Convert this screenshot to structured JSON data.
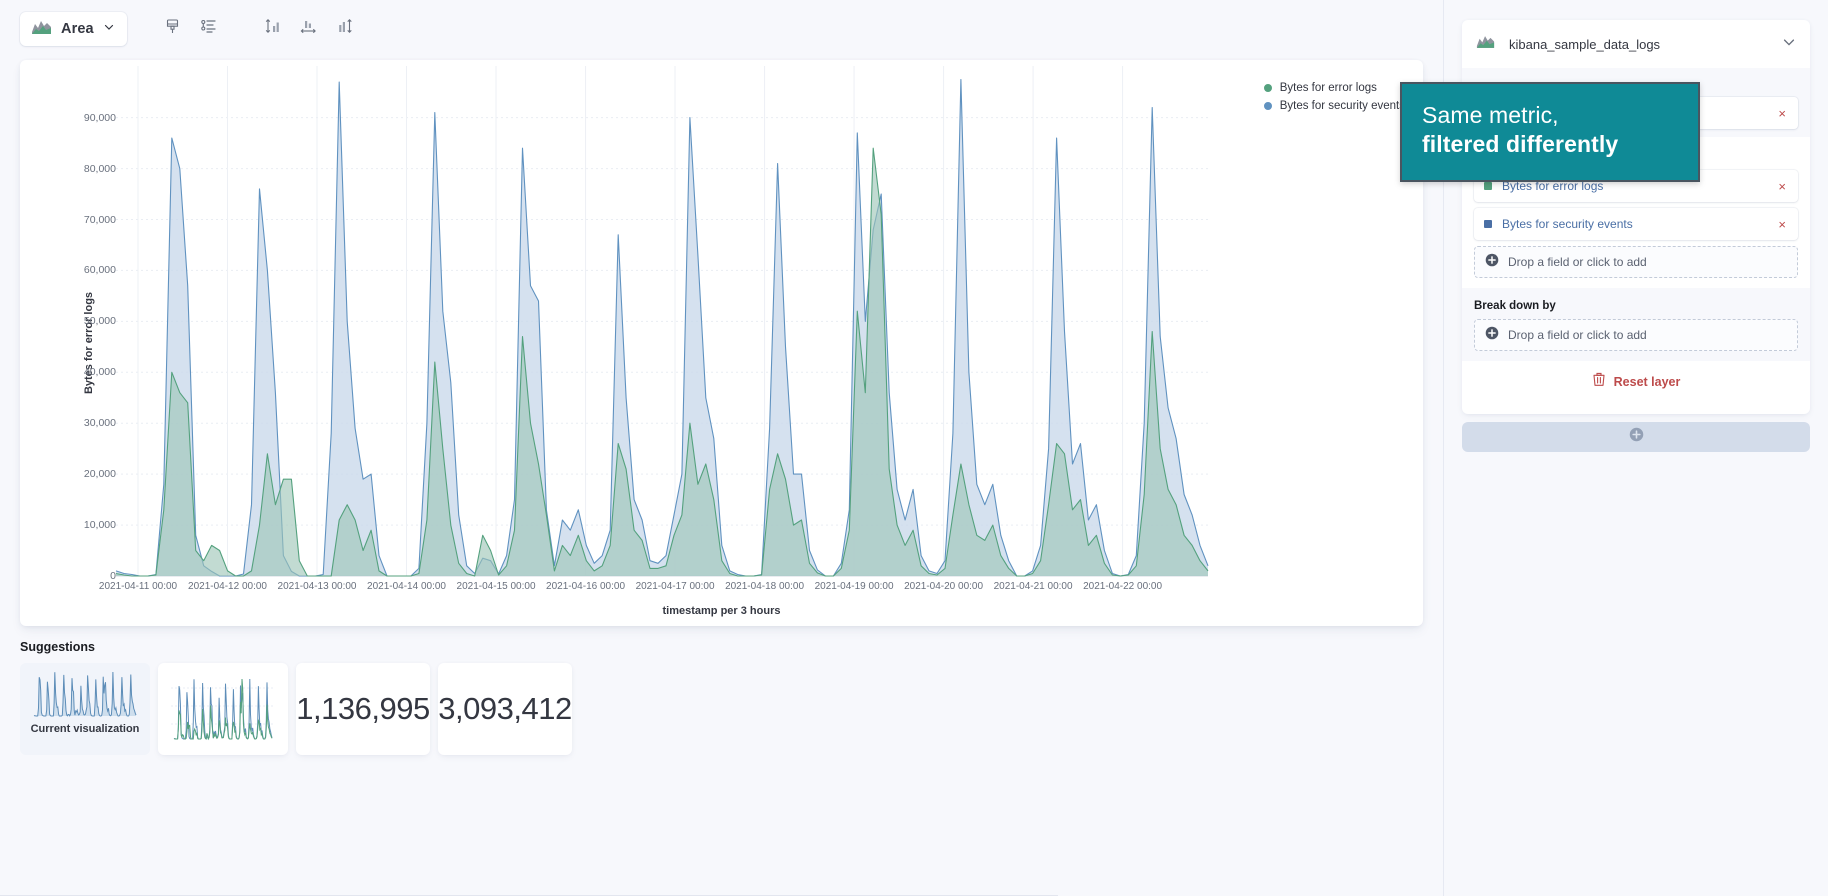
{
  "toolbar": {
    "chart_type_label": "Area",
    "chart_type_icon": "area-chart-icon",
    "buttons": [
      {
        "name": "appearance-button",
        "icon": "brush-icon"
      },
      {
        "name": "legend-settings-button",
        "icon": "legend-list-icon"
      },
      {
        "name": "left-axis-button",
        "icon": "vertical-axis-icon"
      },
      {
        "name": "bottom-axis-button",
        "icon": "horizontal-axis-icon"
      },
      {
        "name": "right-axis-button",
        "icon": "vertical-axis-alt-icon"
      }
    ]
  },
  "chart_data": {
    "type": "area",
    "title": "",
    "xlabel": "timestamp per 3 hours",
    "ylabel": "Bytes for error logs",
    "ylim": [
      0,
      97000
    ],
    "yticks": [
      0,
      10000,
      20000,
      30000,
      40000,
      50000,
      60000,
      70000,
      80000,
      90000
    ],
    "ytick_labels": [
      "0",
      "10,000",
      "20,000",
      "30,000",
      "40,000",
      "50,000",
      "60,000",
      "70,000",
      "80,000",
      "90,000"
    ],
    "grid": true,
    "legend_position": "top-right",
    "xticks": [
      "2021-04-11 00:00",
      "2021-04-12 00:00",
      "2021-04-13 00:00",
      "2021-04-14 00:00",
      "2021-04-15 00:00",
      "2021-04-16 00:00",
      "2021-04-17 00:00",
      "2021-04-18 00:00",
      "2021-04-19 00:00",
      "2021-04-20 00:00",
      "2021-04-21 00:00",
      "2021-04-22 00:00"
    ],
    "series": [
      {
        "name": "Bytes for error logs",
        "color": "#6092c0",
        "fill": "#c9d8ea",
        "values": [
          1000,
          500,
          300,
          0,
          0,
          300,
          18000,
          86000,
          80000,
          57000,
          8000,
          2000,
          900,
          0,
          0,
          0,
          400,
          14000,
          76000,
          60000,
          36000,
          4000,
          900,
          0,
          0,
          0,
          300,
          28000,
          97000,
          50000,
          29000,
          19000,
          20000,
          4000,
          0,
          0,
          0,
          0,
          1500,
          30000,
          91000,
          52000,
          38000,
          12000,
          2000,
          500,
          3500,
          3000,
          400,
          4000,
          15000,
          84000,
          57000,
          54000,
          13000,
          2000,
          11000,
          9000,
          13000,
          6000,
          2500,
          4000,
          9000,
          67000,
          35000,
          15000,
          11000,
          3000,
          2500,
          4000,
          12000,
          20000,
          90000,
          63000,
          35000,
          27000,
          6000,
          1000,
          300,
          0,
          0,
          300,
          29000,
          81000,
          45000,
          20000,
          20000,
          5000,
          1200,
          0,
          0,
          2500,
          13000,
          87000,
          50000,
          68000,
          75000,
          36000,
          17000,
          11000,
          17000,
          4000,
          1000,
          500,
          3000,
          28000,
          97500,
          40000,
          18000,
          14000,
          18000,
          8000,
          3000,
          0,
          0,
          1000,
          6000,
          25000,
          86000,
          48000,
          22000,
          26000,
          11000,
          14000,
          5000,
          500,
          0,
          300,
          4000,
          30000,
          92000,
          47000,
          33000,
          27000,
          16000,
          12000,
          6000,
          2000
        ]
      },
      {
        "name": "Bytes for security events",
        "color": "#54a17e",
        "fill": "#9dc5b6",
        "values": [
          500,
          200,
          0,
          0,
          0,
          200,
          13000,
          40000,
          36000,
          34000,
          5000,
          3000,
          6000,
          5000,
          1000,
          0,
          0,
          1000,
          10000,
          24000,
          14000,
          19000,
          19000,
          3000,
          0,
          0,
          0,
          0,
          11000,
          14000,
          11000,
          5000,
          9000,
          1000,
          0,
          0,
          0,
          0,
          500,
          11000,
          42000,
          25000,
          10000,
          2500,
          500,
          0,
          8000,
          5000,
          200,
          2000,
          9000,
          47000,
          30000,
          22000,
          12000,
          1000,
          6000,
          4000,
          8000,
          3000,
          1000,
          2000,
          6000,
          26000,
          21000,
          9000,
          7000,
          1500,
          1500,
          2000,
          8000,
          12000,
          30000,
          18000,
          22000,
          15000,
          3000,
          500,
          0,
          0,
          0,
          200,
          17000,
          24000,
          19000,
          10000,
          11000,
          2500,
          600,
          0,
          0,
          1500,
          9000,
          52000,
          36000,
          84000,
          71000,
          21000,
          10000,
          6000,
          9000,
          2000,
          500,
          200,
          1500,
          12000,
          22000,
          14000,
          8000,
          7000,
          10000,
          4000,
          1500,
          0,
          0,
          500,
          3000,
          14000,
          26000,
          24000,
          13000,
          15000,
          6000,
          8000,
          2500,
          200,
          0,
          200,
          2000,
          16000,
          48000,
          25000,
          17000,
          14000,
          8000,
          6000,
          3000,
          1000
        ]
      }
    ]
  },
  "legend": [
    {
      "label": "Bytes for error logs",
      "color": "#54a17e"
    },
    {
      "label": "Bytes for security events",
      "color": "#6092c0"
    }
  ],
  "suggestions": {
    "title": "Suggestions",
    "items": [
      {
        "name": "suggestion-current",
        "kind": "thumbnail",
        "caption": "Current visualization",
        "selected": true
      },
      {
        "name": "suggestion-line",
        "kind": "thumbnail",
        "caption": "",
        "selected": false
      },
      {
        "name": "suggestion-metric-1",
        "kind": "metric",
        "value": "1,136,995",
        "selected": false
      },
      {
        "name": "suggestion-metric-2",
        "kind": "metric",
        "value": "3,093,412",
        "selected": false
      }
    ]
  },
  "sidebar": {
    "datasource": {
      "name": "kibana_sample_data_logs",
      "icon": "area-chart-icon",
      "chevron": "chevron-down-icon"
    },
    "groups": [
      {
        "name": "horizontal-axis-group",
        "label": "",
        "chips": [
          {
            "text": "",
            "color": "#6092c0",
            "remove": "×"
          }
        ],
        "dropzone": null
      },
      {
        "name": "vertical-axis-group",
        "label": "",
        "chips": [
          {
            "text": "Bytes for error logs",
            "color": "#54a17e",
            "remove": "×"
          },
          {
            "text": "Bytes for security events",
            "color": "#4a6fa5",
            "remove": "×"
          }
        ],
        "dropzone": "Drop a field or click to add"
      },
      {
        "name": "break-down-by-group",
        "label": "Break down by",
        "chips": [],
        "dropzone": "Drop a field or click to add"
      }
    ],
    "reset_layer": {
      "label": "Reset layer",
      "icon": "trash-icon"
    },
    "add_layer": {
      "icon": "plus-circle-icon"
    }
  },
  "callout": {
    "line1": "Same metric,",
    "line2": "filtered differently",
    "background": "#0f8a96",
    "border": "#4a5560"
  }
}
